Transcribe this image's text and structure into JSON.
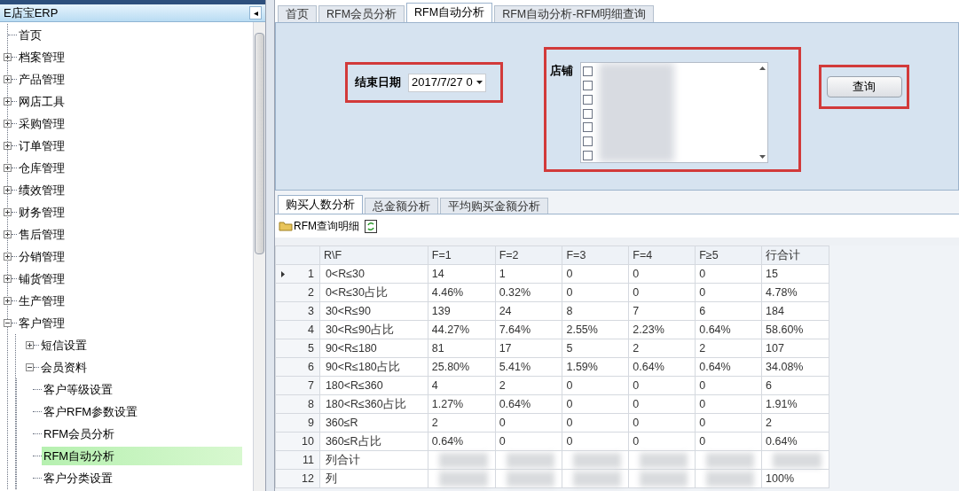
{
  "sidebar": {
    "title": "E店宝ERP",
    "collapse_icon": "◂",
    "tree": [
      {
        "label": "首页",
        "selected": false
      },
      {
        "label": "档案管理",
        "expanded": false,
        "selected": false
      },
      {
        "label": "产品管理",
        "expanded": false,
        "selected": false
      },
      {
        "label": "网店工具",
        "expanded": false,
        "selected": false
      },
      {
        "label": "采购管理",
        "expanded": false,
        "selected": false
      },
      {
        "label": "订单管理",
        "expanded": false,
        "selected": false
      },
      {
        "label": "仓库管理",
        "expanded": false,
        "selected": false
      },
      {
        "label": "绩效管理",
        "expanded": false,
        "selected": false
      },
      {
        "label": "财务管理",
        "expanded": false,
        "selected": false
      },
      {
        "label": "售后管理",
        "expanded": false,
        "selected": false
      },
      {
        "label": "分销管理",
        "expanded": false,
        "selected": false
      },
      {
        "label": "铺货管理",
        "expanded": false,
        "selected": false
      },
      {
        "label": "生产管理",
        "expanded": false,
        "selected": false
      },
      {
        "label": "客户管理",
        "expanded": true,
        "selected": false,
        "children": [
          {
            "label": "短信设置",
            "expanded": false,
            "selected": false
          },
          {
            "label": "会员资料",
            "expanded": true,
            "selected": false,
            "children": [
              {
                "label": "客户等级设置",
                "selected": false
              },
              {
                "label": "客户RFM参数设置",
                "selected": false
              },
              {
                "label": "RFM会员分析",
                "selected": false
              },
              {
                "label": "RFM自动分析",
                "selected": true
              },
              {
                "label": "客户分类设置",
                "selected": false
              }
            ]
          }
        ]
      }
    ]
  },
  "tabs": [
    {
      "label": "首页",
      "selected": false
    },
    {
      "label": "RFM会员分析",
      "selected": false
    },
    {
      "label": "RFM自动分析",
      "selected": true
    },
    {
      "label": "RFM自动分析-RFM明细查询",
      "selected": false
    }
  ],
  "filters": {
    "end_date_label": "结束日期",
    "end_date": "2017/7/27 0",
    "store_label": "店铺",
    "stores": [
      {
        "checked": false
      },
      {
        "checked": false
      },
      {
        "checked": false
      },
      {
        "checked": false
      },
      {
        "checked": false
      },
      {
        "checked": false
      },
      {
        "checked": false
      }
    ],
    "query_button": "查询"
  },
  "sub_tabs": [
    {
      "label": "购买人数分析",
      "selected": true
    },
    {
      "label": "总金额分析",
      "selected": false
    },
    {
      "label": "平均购买金额分析",
      "selected": false
    }
  ],
  "toolbar": {
    "detail_button": "RFM查询明细"
  },
  "table": {
    "columns": [
      "R\\F",
      "F=1",
      "F=2",
      "F=3",
      "F=4",
      "F≥5",
      "行合计"
    ],
    "rows": [
      {
        "num": "1",
        "current": true,
        "label": "0<R≤30",
        "values": [
          "14",
          "1",
          "0",
          "0",
          "0",
          "15"
        ]
      },
      {
        "num": "2",
        "current": false,
        "label": "0<R≤30占比",
        "values": [
          "4.46%",
          "0.32%",
          "0",
          "0",
          "0",
          "4.78%"
        ]
      },
      {
        "num": "3",
        "current": false,
        "label": "30<R≤90",
        "values": [
          "139",
          "24",
          "8",
          "7",
          "6",
          "184"
        ]
      },
      {
        "num": "4",
        "current": false,
        "label": "30<R≤90占比",
        "values": [
          "44.27%",
          "7.64%",
          "2.55%",
          "2.23%",
          "0.64%",
          "58.60%"
        ]
      },
      {
        "num": "5",
        "current": false,
        "label": "90<R≤180",
        "values": [
          "81",
          "17",
          "5",
          "2",
          "2",
          "107"
        ]
      },
      {
        "num": "6",
        "current": false,
        "label": "90<R≤180占比",
        "values": [
          "25.80%",
          "5.41%",
          "1.59%",
          "0.64%",
          "0.64%",
          "34.08%"
        ]
      },
      {
        "num": "7",
        "current": false,
        "label": "180<R≤360",
        "values": [
          "4",
          "2",
          "0",
          "0",
          "0",
          "6"
        ]
      },
      {
        "num": "8",
        "current": false,
        "label": "180<R≤360占比",
        "values": [
          "1.27%",
          "0.64%",
          "0",
          "0",
          "0",
          "1.91%"
        ]
      },
      {
        "num": "9",
        "current": false,
        "label": "360≤R",
        "values": [
          "2",
          "0",
          "0",
          "0",
          "0",
          "2"
        ]
      },
      {
        "num": "10",
        "current": false,
        "label": "360≤R占比",
        "values": [
          "0.64%",
          "0",
          "0",
          "0",
          "0",
          "0.64%"
        ]
      },
      {
        "num": "11",
        "current": false,
        "label": "列合计",
        "blurred": true
      },
      {
        "num": "12",
        "current": false,
        "label": "列",
        "blurred": true,
        "total": "100%"
      }
    ]
  }
}
